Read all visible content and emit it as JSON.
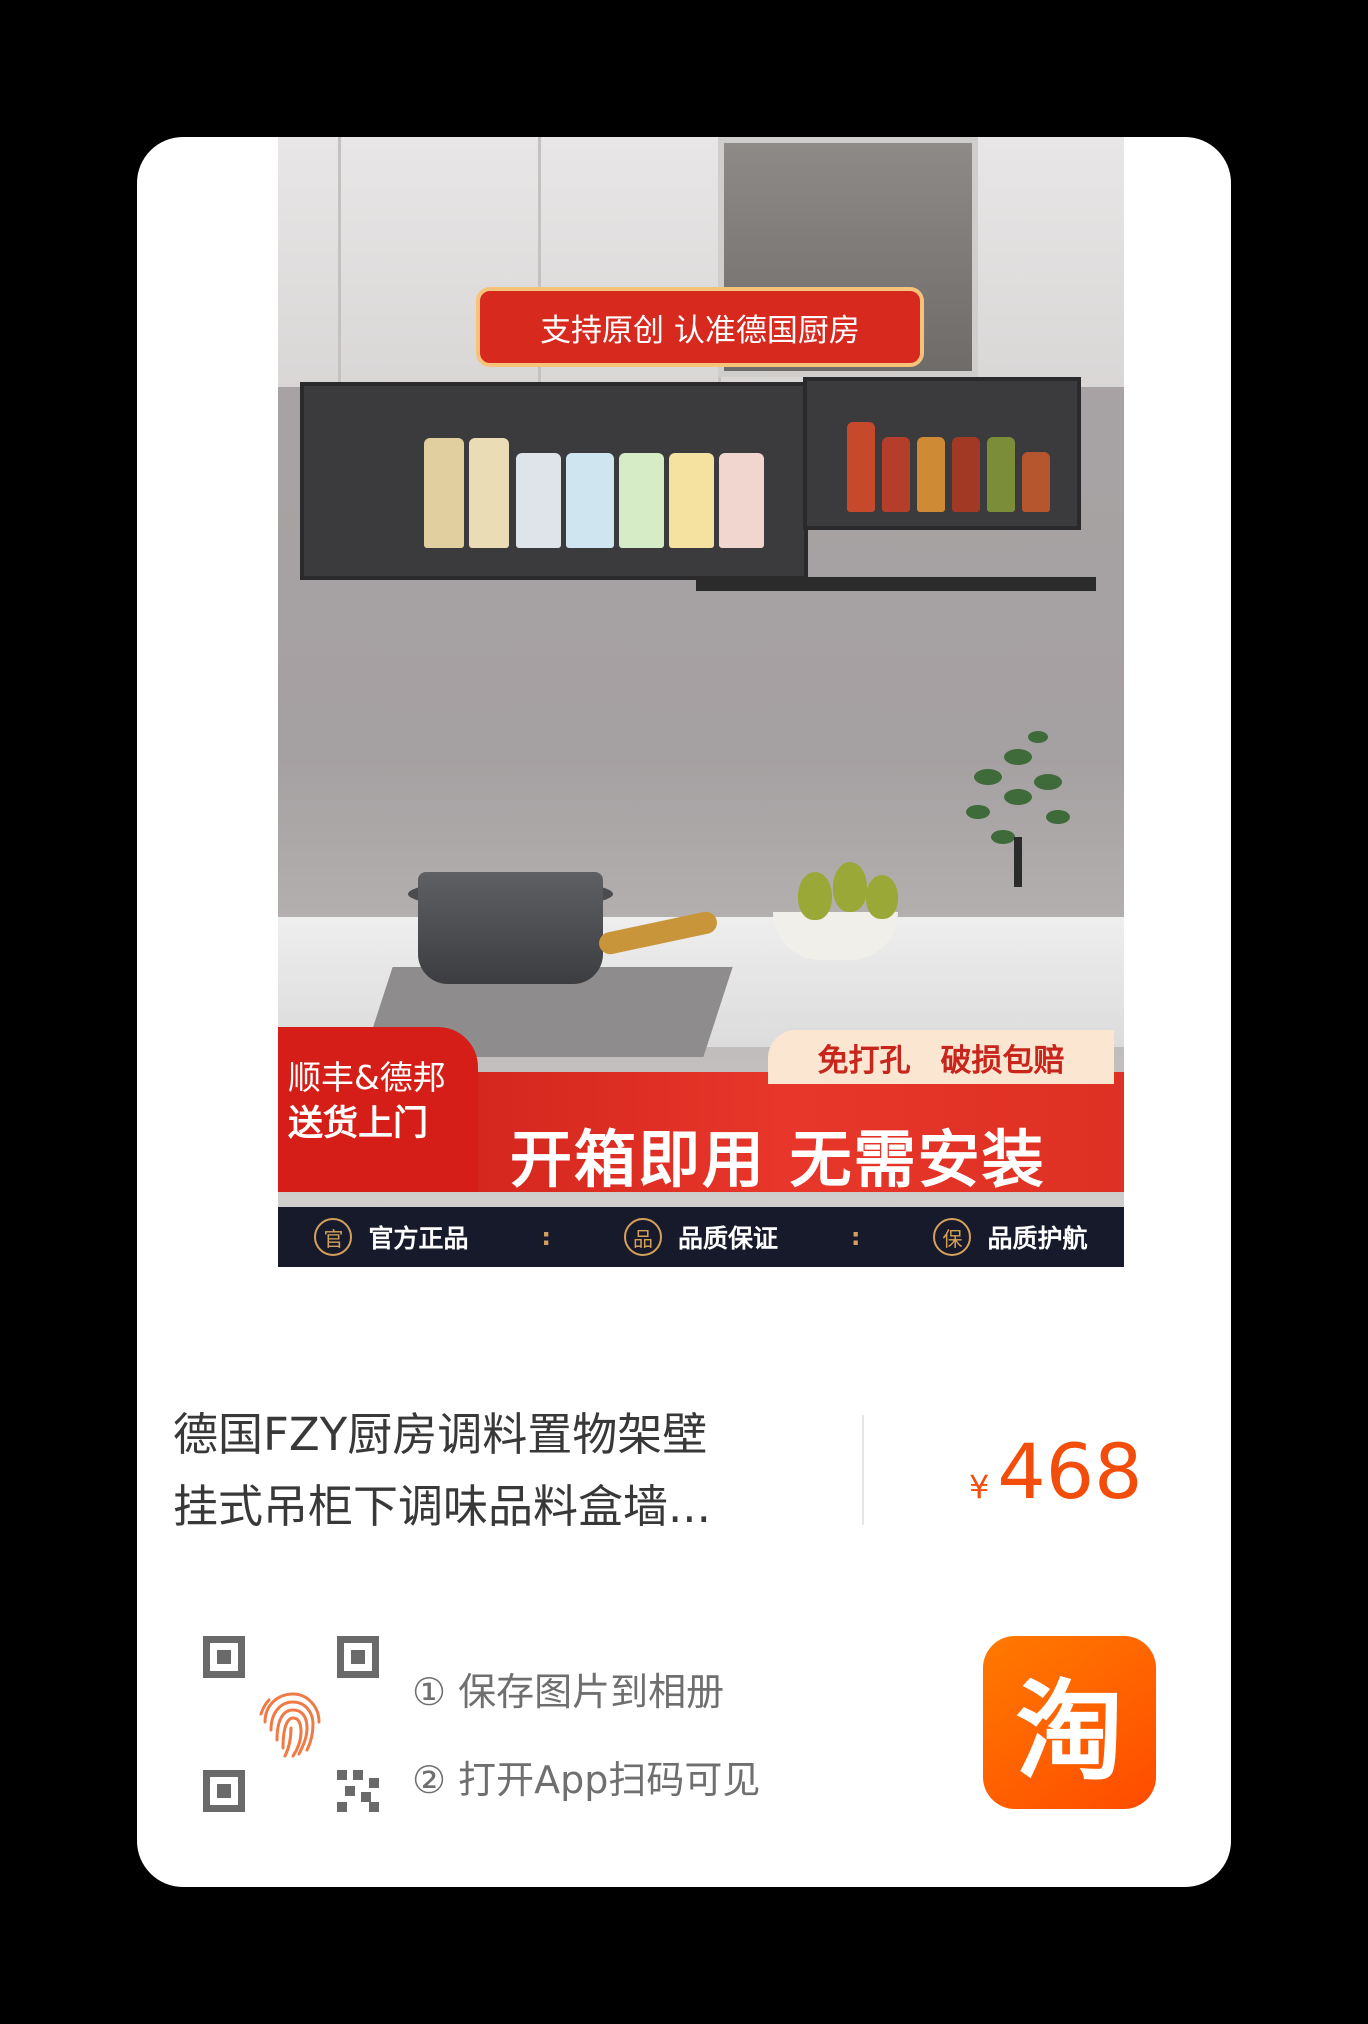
{
  "product_image": {
    "top_banner": "支持原创 认准德国厨房",
    "delivery_tag_line1": "顺丰&德邦",
    "delivery_tag_line2": "送货上门",
    "promo_pill_a": "免打孔",
    "promo_pill_b": "破损包赔",
    "slogan": "开箱即用 无需安装",
    "badges": [
      {
        "seal": "官",
        "label": "官方正品"
      },
      {
        "seal": "品",
        "label": "品质保证"
      },
      {
        "seal": "保",
        "label": "品质护航"
      }
    ],
    "badge_separator": ":"
  },
  "product": {
    "title_line1": "德国FZY厨房调料置物架壁",
    "title_line2": "挂式吊柜下调味品料盒墙...",
    "currency": "¥",
    "price": "468"
  },
  "share": {
    "step1": "① 保存图片到相册",
    "step2": "② 打开App扫码可见",
    "app_icon_glyph": "淘"
  },
  "colors": {
    "price": "#f24d0b",
    "promo_red": "#d8291f",
    "app_orange": "#ff5a00"
  }
}
